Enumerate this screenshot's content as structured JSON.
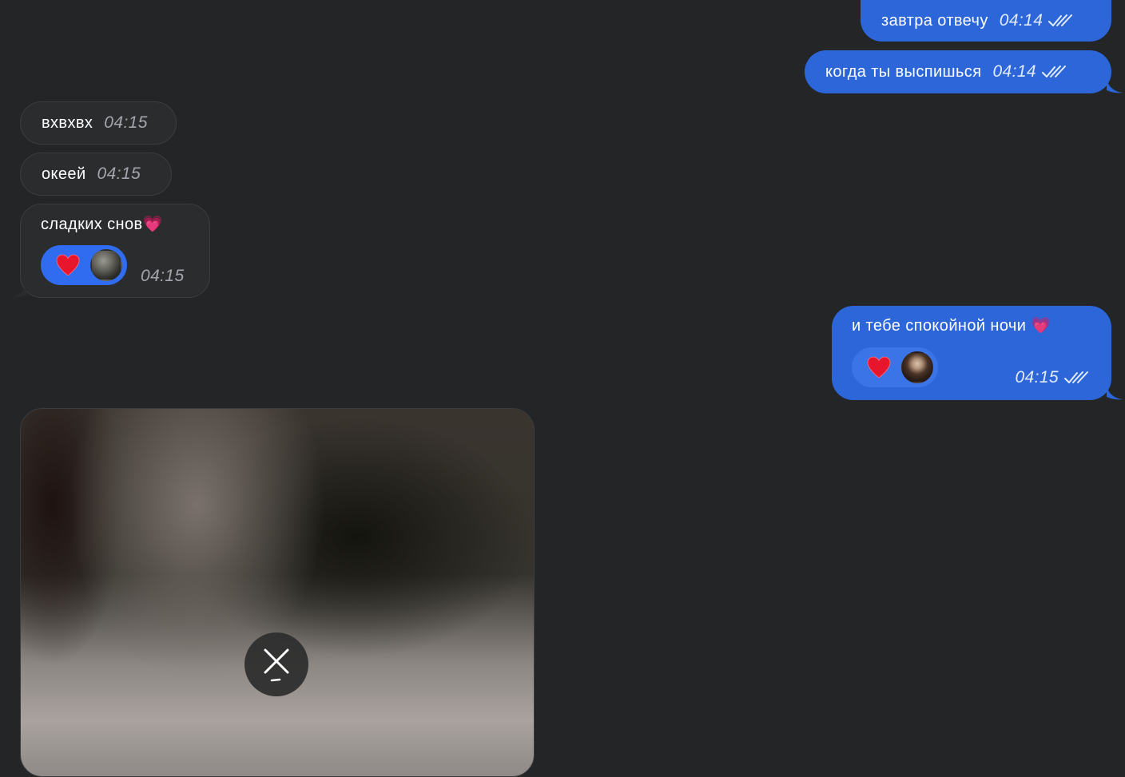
{
  "colors": {
    "background": "#232527",
    "outgoing_bubble": "#2c66d9",
    "incoming_bubble": "#2b2c2e",
    "reaction_pill": "#2f6cf0"
  },
  "messages": [
    {
      "direction": "outgoing",
      "text": "завтра отвечу",
      "time": "04:14",
      "status": "read-double-check-icon"
    },
    {
      "direction": "outgoing",
      "text": "когда ты выспишься",
      "time": "04:14",
      "status": "read-double-check-icon"
    },
    {
      "direction": "incoming",
      "text": "вхвхвх",
      "time": "04:15"
    },
    {
      "direction": "incoming",
      "text": "океей",
      "time": "04:15"
    },
    {
      "direction": "incoming",
      "text": "сладких снов💗",
      "time": "04:15",
      "reaction": {
        "emoji": "heart-icon",
        "avatar": "avatar"
      }
    },
    {
      "direction": "outgoing",
      "text": "и тебе спокойной ночи 💗",
      "time": "04:15",
      "status": "read-double-check-icon",
      "reaction": {
        "emoji": "heart-icon",
        "avatar": "avatar"
      }
    }
  ],
  "media": {
    "type": "blurred-image",
    "action_icon": "close-icon"
  }
}
